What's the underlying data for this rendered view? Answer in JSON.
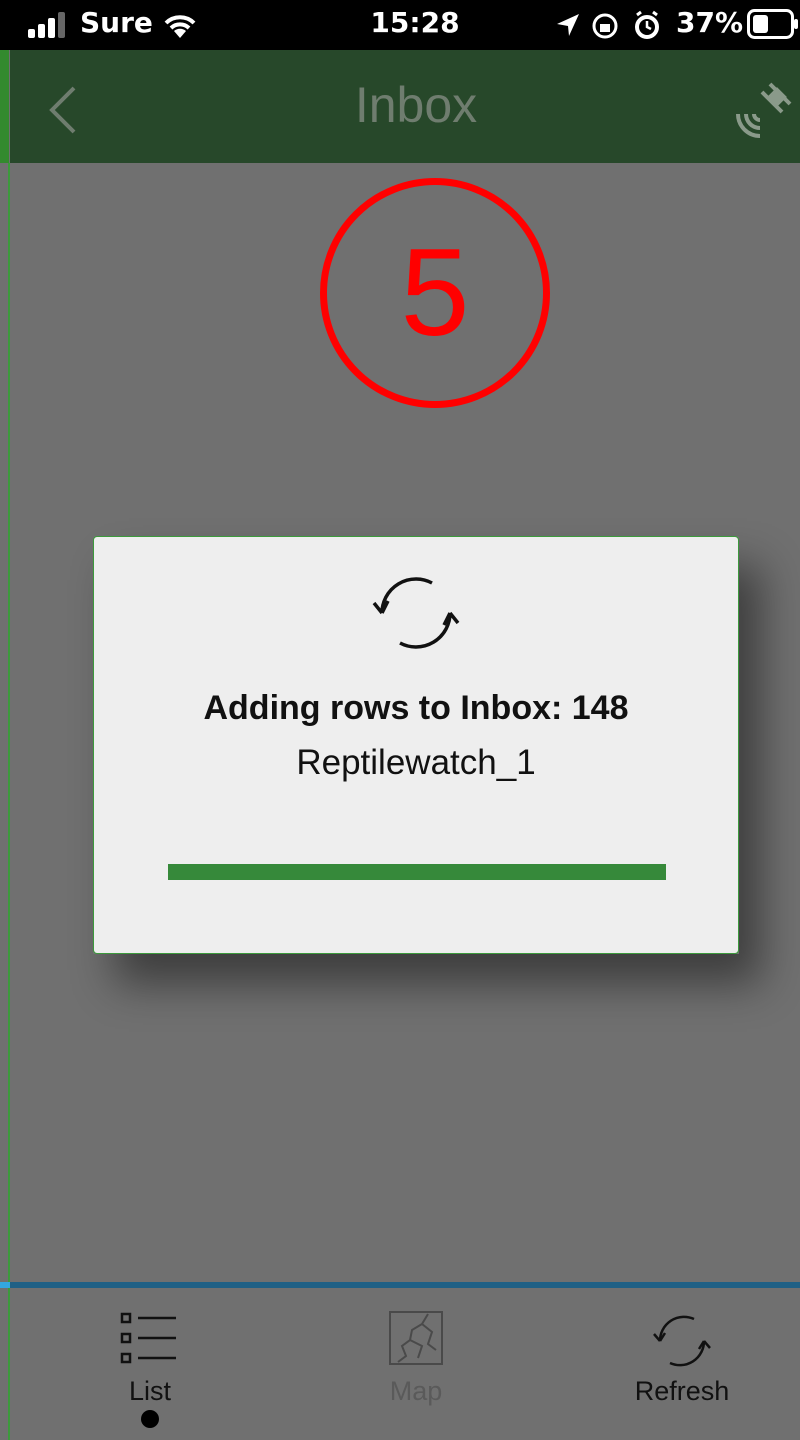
{
  "status_bar": {
    "carrier": "Sure",
    "time": "15:28",
    "battery_percent": "37%",
    "icons": [
      "signal-icon",
      "wifi-icon",
      "location-arrow-icon",
      "orientation-lock-icon",
      "alarm-icon",
      "battery-icon"
    ]
  },
  "navbar": {
    "title": "Inbox",
    "back_icon": "chevron-left-icon",
    "gps_icon": "satellite-icon"
  },
  "annotation": {
    "step_number": "5"
  },
  "dialog": {
    "icon": "sync-icon",
    "title": "Adding rows to Inbox: 148",
    "subtitle": "Reptilewatch_1",
    "progress": 1.0
  },
  "tabs": [
    {
      "label": "List",
      "icon": "list-icon",
      "active": true
    },
    {
      "label": "Map",
      "icon": "map-icon",
      "active": false
    },
    {
      "label": "Refresh",
      "icon": "refresh-icon",
      "active": false
    }
  ],
  "colors": {
    "navbar_bg": "#27482a",
    "overlay_bg": "#707070",
    "accent_green": "#36893a",
    "annotation_red": "#ff0000",
    "tab_separator": "#1f6085"
  }
}
